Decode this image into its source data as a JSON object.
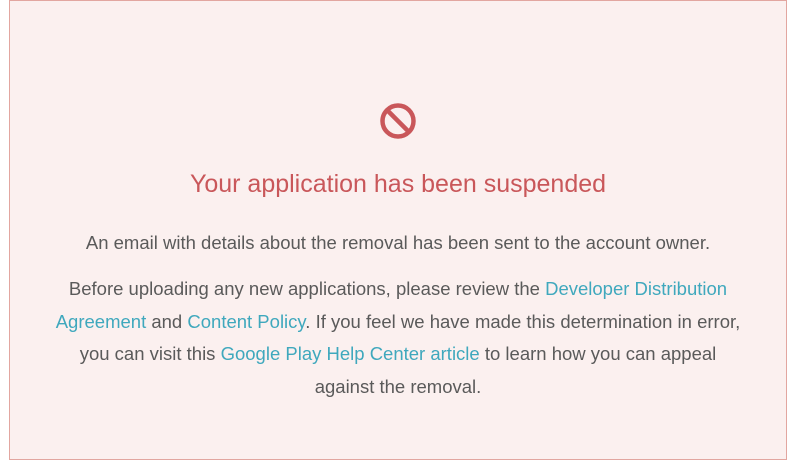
{
  "notice": {
    "icon": "prohibited-icon",
    "title": "Your application has been suspended",
    "email_notice": "An email with details about the removal has been sent to the account owner.",
    "paragraph": {
      "text_1": "Before uploading any new applications, please review the ",
      "link_dda": "Developer Distribution Agreement",
      "text_2": " and ",
      "link_policy": "Content Policy",
      "text_3": ". If you feel we have made this determination in error, you can visit this ",
      "link_help": "Google Play Help Center article",
      "text_4": " to learn how you can appeal against the removal."
    }
  },
  "colors": {
    "title": "#c9575a",
    "link": "#3fa8bd",
    "background": "#fbf0ef",
    "border": "#e2a6a0",
    "text": "#5a5a5a"
  }
}
